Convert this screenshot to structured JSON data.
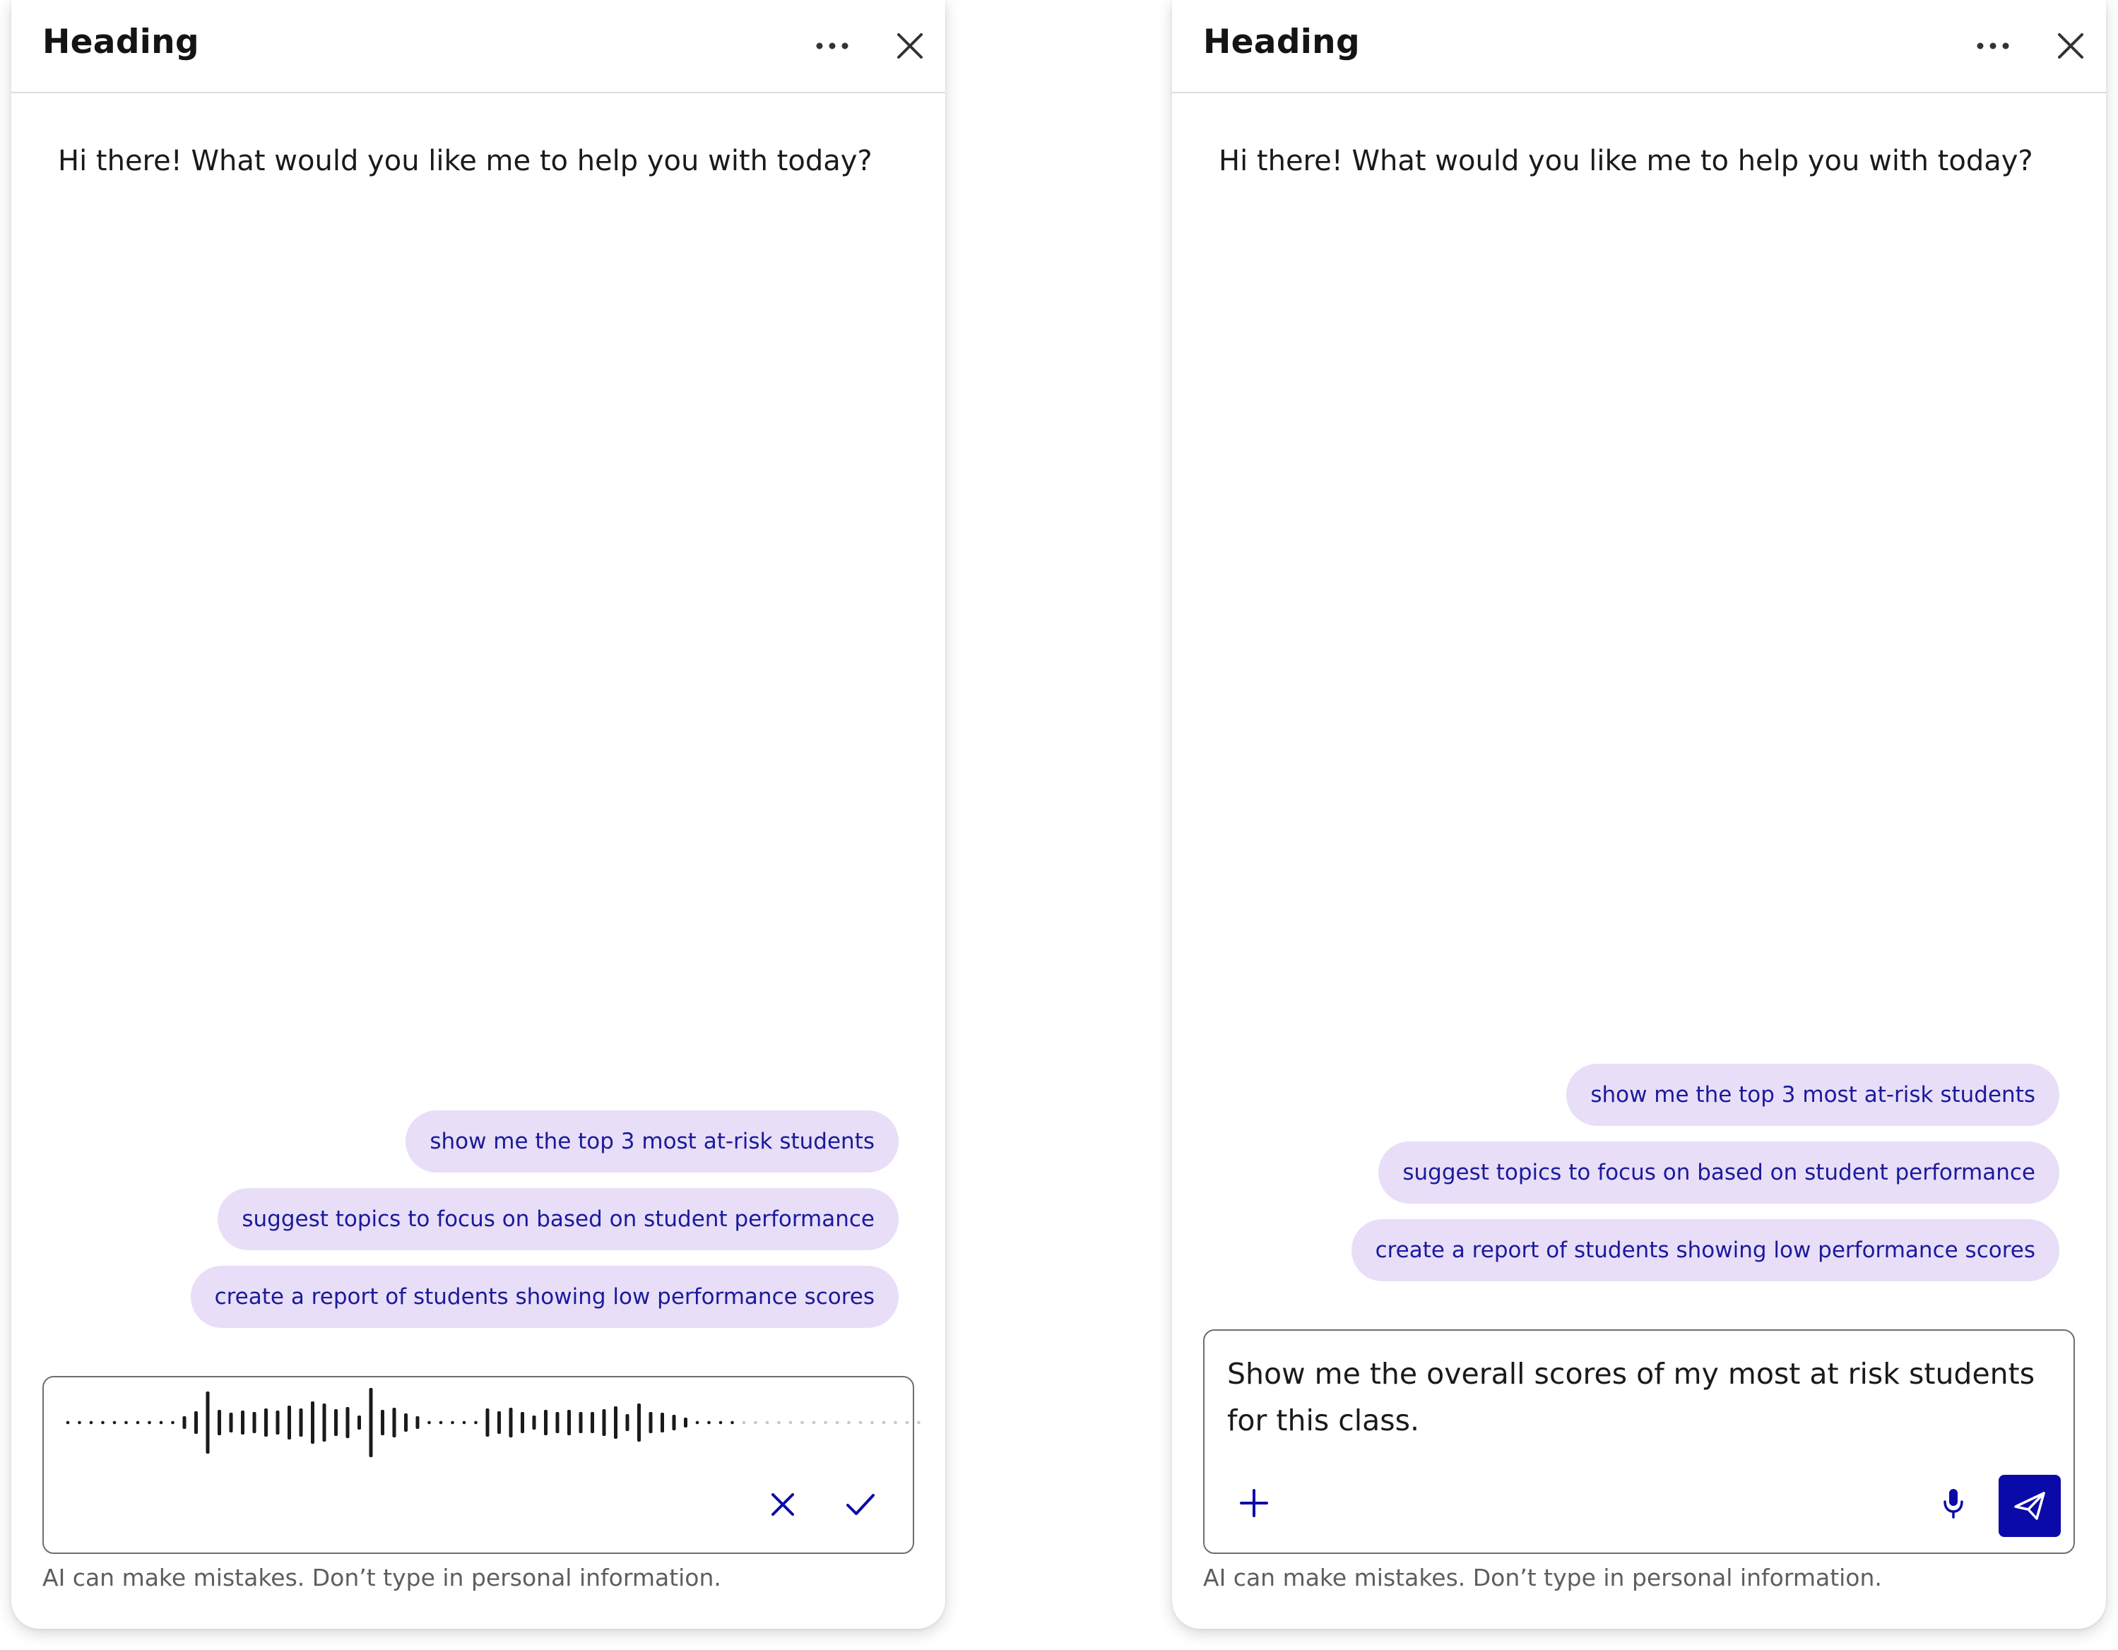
{
  "colors": {
    "accent": "#0a0aa8",
    "chip_bg": "#e8def8",
    "chip_text": "#1a1a9a"
  },
  "icons": {
    "more": "more-horizontal-icon",
    "close": "close-icon",
    "cancel": "x-icon",
    "confirm": "check-icon",
    "add": "plus-icon",
    "mic": "microphone-icon",
    "send": "send-icon"
  },
  "left_panel": {
    "heading": "Heading",
    "greeting": "Hi there! What would you like me to help you with today?",
    "suggestions": [
      "show me the top 3 most at-risk students",
      "suggest topics to focus on based on student performance",
      "create a report of students showing low performance scores"
    ],
    "disclaimer": "AI can make mistakes. Don’t type in personal information."
  },
  "right_panel": {
    "heading": "Heading",
    "greeting": "Hi there! What would you like me to help you with today?",
    "suggestions": [
      "show me the top 3 most at-risk students",
      "suggest topics to focus on based on student performance",
      "create a report of students showing low performance scores"
    ],
    "input_value": "Show me the overall scores of my most at risk students for this class.",
    "disclaimer": "AI can make mistakes. Don’t type in personal information."
  }
}
